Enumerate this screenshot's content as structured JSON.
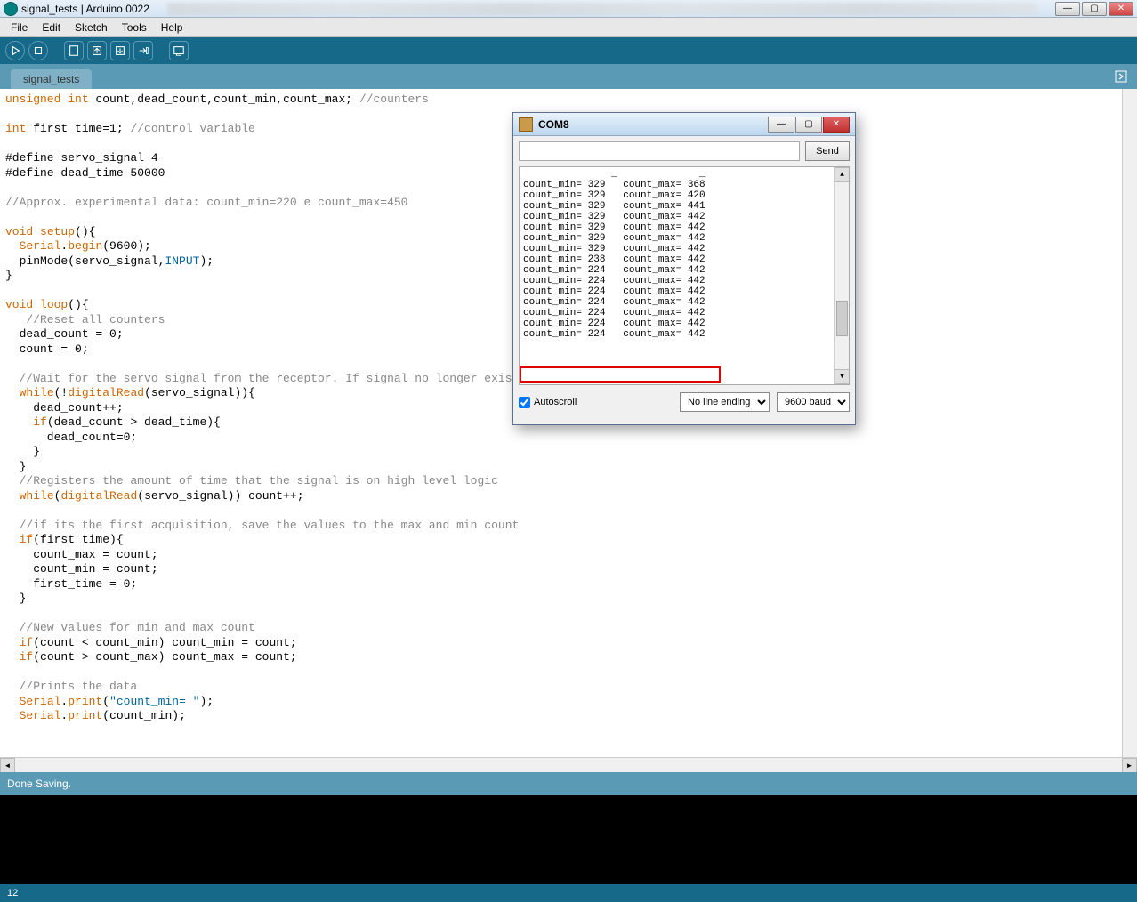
{
  "window": {
    "title": "signal_tests | Arduino 0022",
    "min_label": "—",
    "max_label": "▢",
    "close_label": "✕"
  },
  "menu": {
    "file": "File",
    "edit": "Edit",
    "sketch": "Sketch",
    "tools": "Tools",
    "help": "Help"
  },
  "tabs": {
    "tab1": "signal_tests"
  },
  "status": {
    "message": "Done Saving."
  },
  "footer": {
    "line": "12"
  },
  "serial": {
    "title": "COM8",
    "send": "Send",
    "autoscroll": "Autoscroll",
    "line_ending": "No line ending",
    "baud": "9600 baud",
    "lines": [
      "count_min= 329   count_max= 368",
      "count_min= 329   count_max= 420",
      "count_min= 329   count_max= 441",
      "count_min= 329   count_max= 442",
      "count_min= 329   count_max= 442",
      "count_min= 329   count_max= 442",
      "count_min= 329   count_max= 442",
      "count_min= 238   count_max= 442",
      "count_min= 224   count_max= 442",
      "count_min= 224   count_max= 442",
      "count_min= 224   count_max= 442",
      "count_min= 224   count_max= 442",
      "count_min= 224   count_max= 442",
      "count_min= 224   count_max= 442"
    ],
    "highlighted": "count_min= 224   count_max= 442"
  },
  "code": {
    "l1a": "unsigned",
    "l1b": " int",
    "l1c": " count,dead_count,count_min,count_max; ",
    "l1d": "//counters",
    "l3a": "int",
    "l3b": " first_time=1; ",
    "l3c": "//control variable",
    "l5": "#define servo_signal 4",
    "l6": "#define dead_time 50000",
    "l8": "//Approx. experimental data: count_min=220 e count_max=450",
    "l10a": "void",
    "l10b": " ",
    "l10c": "setup",
    "l10d": "(){",
    "l11a": "  ",
    "l11b": "Serial",
    "l11c": ".",
    "l11d": "begin",
    "l11e": "(9600);",
    "l12a": "  pinMode(servo_signal,",
    "l12b": "INPUT",
    "l12c": ");",
    "l13": "}",
    "l15a": "void",
    "l15b": " ",
    "l15c": "loop",
    "l15d": "(){",
    "l16": "   //Reset all counters",
    "l17": "  dead_count = 0;",
    "l18": "  count = 0;",
    "l20": "  //Wait for the servo signal from the receptor. If signal no longer exists (LOST SI",
    "l21a": "  ",
    "l21b": "while",
    "l21c": "(!",
    "l21d": "digitalRead",
    "l21e": "(servo_signal)){",
    "l22": "    dead_count++;",
    "l23a": "    ",
    "l23b": "if",
    "l23c": "(dead_count > dead_time){",
    "l24": "      dead_count=0;",
    "l25": "    }",
    "l26": "  }",
    "l27": "  //Registers the amount of time that the signal is on high level logic",
    "l28a": "  ",
    "l28b": "while",
    "l28c": "(",
    "l28d": "digitalRead",
    "l28e": "(servo_signal)) count++;",
    "l30": "  //if its the first acquisition, save the values to the max and min count",
    "l31a": "  ",
    "l31b": "if",
    "l31c": "(first_time){",
    "l32": "    count_max = count;",
    "l33": "    count_min = count;",
    "l34": "    first_time = 0;",
    "l35": "  }",
    "l37": "  //New values for min and max count",
    "l38a": "  ",
    "l38b": "if",
    "l38c": "(count < count_min) count_min = count;",
    "l39a": "  ",
    "l39b": "if",
    "l39c": "(count > count_max) count_max = count;",
    "l41": "  //Prints the data",
    "l42a": "  ",
    "l42b": "Serial",
    "l42c": ".",
    "l42d": "print",
    "l42e": "(",
    "l42f": "\"count_min= \"",
    "l42g": ");",
    "l43a": "  ",
    "l43b": "Serial",
    "l43c": ".",
    "l43d": "print",
    "l43e": "(count_min);"
  }
}
